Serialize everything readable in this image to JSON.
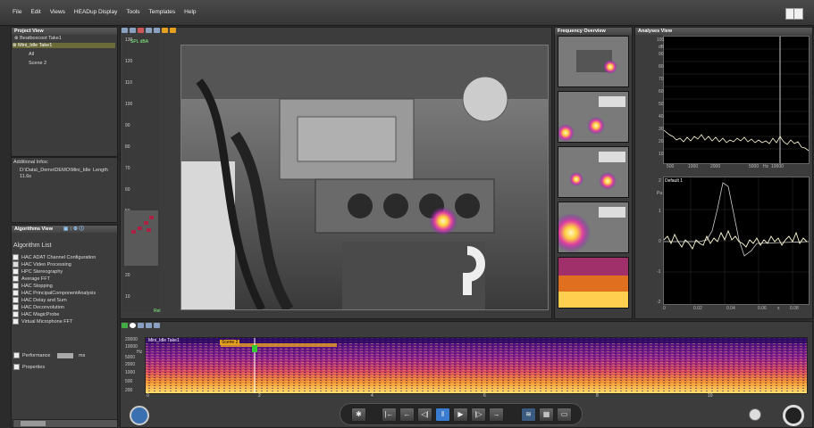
{
  "menu": [
    "File",
    "Edit",
    "Views",
    "HEADup Display",
    "Tools",
    "Templates",
    "Help"
  ],
  "project": {
    "title": "Project View",
    "items": [
      "Beatboxcoot Take1",
      "Mini_Idle Take1",
      "All",
      "Scene 2"
    ],
    "info_title": "Additional Infos:",
    "info_text": "D:\\Data\\_Demo\\DEMO\\Mini_Idle",
    "info_length_label": "Length",
    "info_length": "11.6s"
  },
  "algorithms": {
    "panel_title": "Algorithms View",
    "list_title": "Algorithm List",
    "items": [
      {
        "label": "HAC ADAT Channel Configuration",
        "checked": false
      },
      {
        "label": "HAC Video Processing",
        "checked": true
      },
      {
        "label": "HPC Stereography",
        "checked": false
      },
      {
        "label": "Average FFT",
        "checked": true
      },
      {
        "label": "HAC Stopping",
        "checked": false
      },
      {
        "label": "HAC PrincipalComponentAnalysis",
        "checked": false
      },
      {
        "label": "HAC Delay and Sum",
        "checked": true
      },
      {
        "label": "HAC Deconvolution",
        "checked": false
      },
      {
        "label": "HAC MagicProbe",
        "checked": false
      },
      {
        "label": "Virtual Microphone FFT",
        "checked": true
      }
    ],
    "performance_label": "Performance",
    "performance_unit": "ms",
    "properties_label": "Properties"
  },
  "video": {
    "spl_label": "SPL dBA",
    "rel_label": "Rel",
    "scale": [
      "130",
      "120",
      "110",
      "100",
      "90",
      "80",
      "70",
      "60",
      "50",
      "40",
      "30",
      "20",
      "10"
    ]
  },
  "frequency": {
    "title": "Frequency Overview"
  },
  "analyses": {
    "title": "Analyses View",
    "top_yunit": "dB",
    "top_yticks": [
      "100",
      "90",
      "80",
      "70",
      "60",
      "50",
      "40",
      "30",
      "20",
      "10"
    ],
    "top_xticks": [
      "500",
      "1000",
      "2000",
      "5000",
      "Hz",
      "10000"
    ],
    "bottom_title": "Default 1",
    "bottom_yunit": "Pa",
    "bottom_yticks": [
      "2",
      "1",
      "0",
      "-1",
      "-2"
    ],
    "bottom_xticks": [
      "0",
      "0.02",
      "0.04",
      "0.06",
      "s",
      "0.08"
    ]
  },
  "timeline": {
    "scene_label": "Scene 2",
    "take_label": "Mini_Idle Take1",
    "freq_labels": [
      "20000",
      "10000",
      "Hz",
      "5000",
      "2000",
      "1000",
      "500",
      "200"
    ],
    "time_ticks": [
      "0",
      "2",
      "4",
      "6",
      "8",
      "10"
    ]
  },
  "colors": {
    "accent": "#e6a020",
    "highlight": "#6b6b3a",
    "bg": "#2b2b2b"
  }
}
